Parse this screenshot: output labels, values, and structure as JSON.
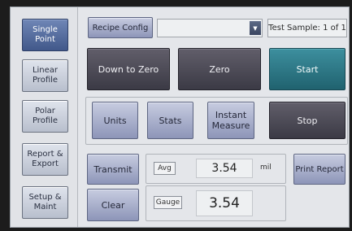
{
  "sidebar": {
    "items": [
      {
        "label": "Single Point",
        "active": true
      },
      {
        "label": "Linear Profile",
        "active": false
      },
      {
        "label": "Polar Profile",
        "active": false
      },
      {
        "label": "Report & Export",
        "active": false
      },
      {
        "label": "Setup & Maint",
        "active": false
      }
    ]
  },
  "toolbar": {
    "recipe_config_label": "Recipe Config",
    "recipe_dropdown_value": "",
    "sample_status": "Test Sample: 1 of 1"
  },
  "actions": {
    "down_to_zero_label": "Down to Zero",
    "zero_label": "Zero",
    "start_label": "Start",
    "units_label": "Units",
    "stats_label": "Stats",
    "instant_measure_label": "Instant Measure",
    "stop_label": "Stop",
    "transmit_label": "Transmit",
    "clear_label": "Clear",
    "print_report_label": "Print Report"
  },
  "readings": {
    "avg_label": "Avg",
    "avg_value": "3.54",
    "avg_unit": "mil",
    "gauge_label": "Gauge",
    "gauge_value": "3.54"
  },
  "colors": {
    "active_nav": "#41588a",
    "action_lavender": "#8d95b8",
    "action_dark": "#3b3a45",
    "start_teal": "#20626f"
  }
}
